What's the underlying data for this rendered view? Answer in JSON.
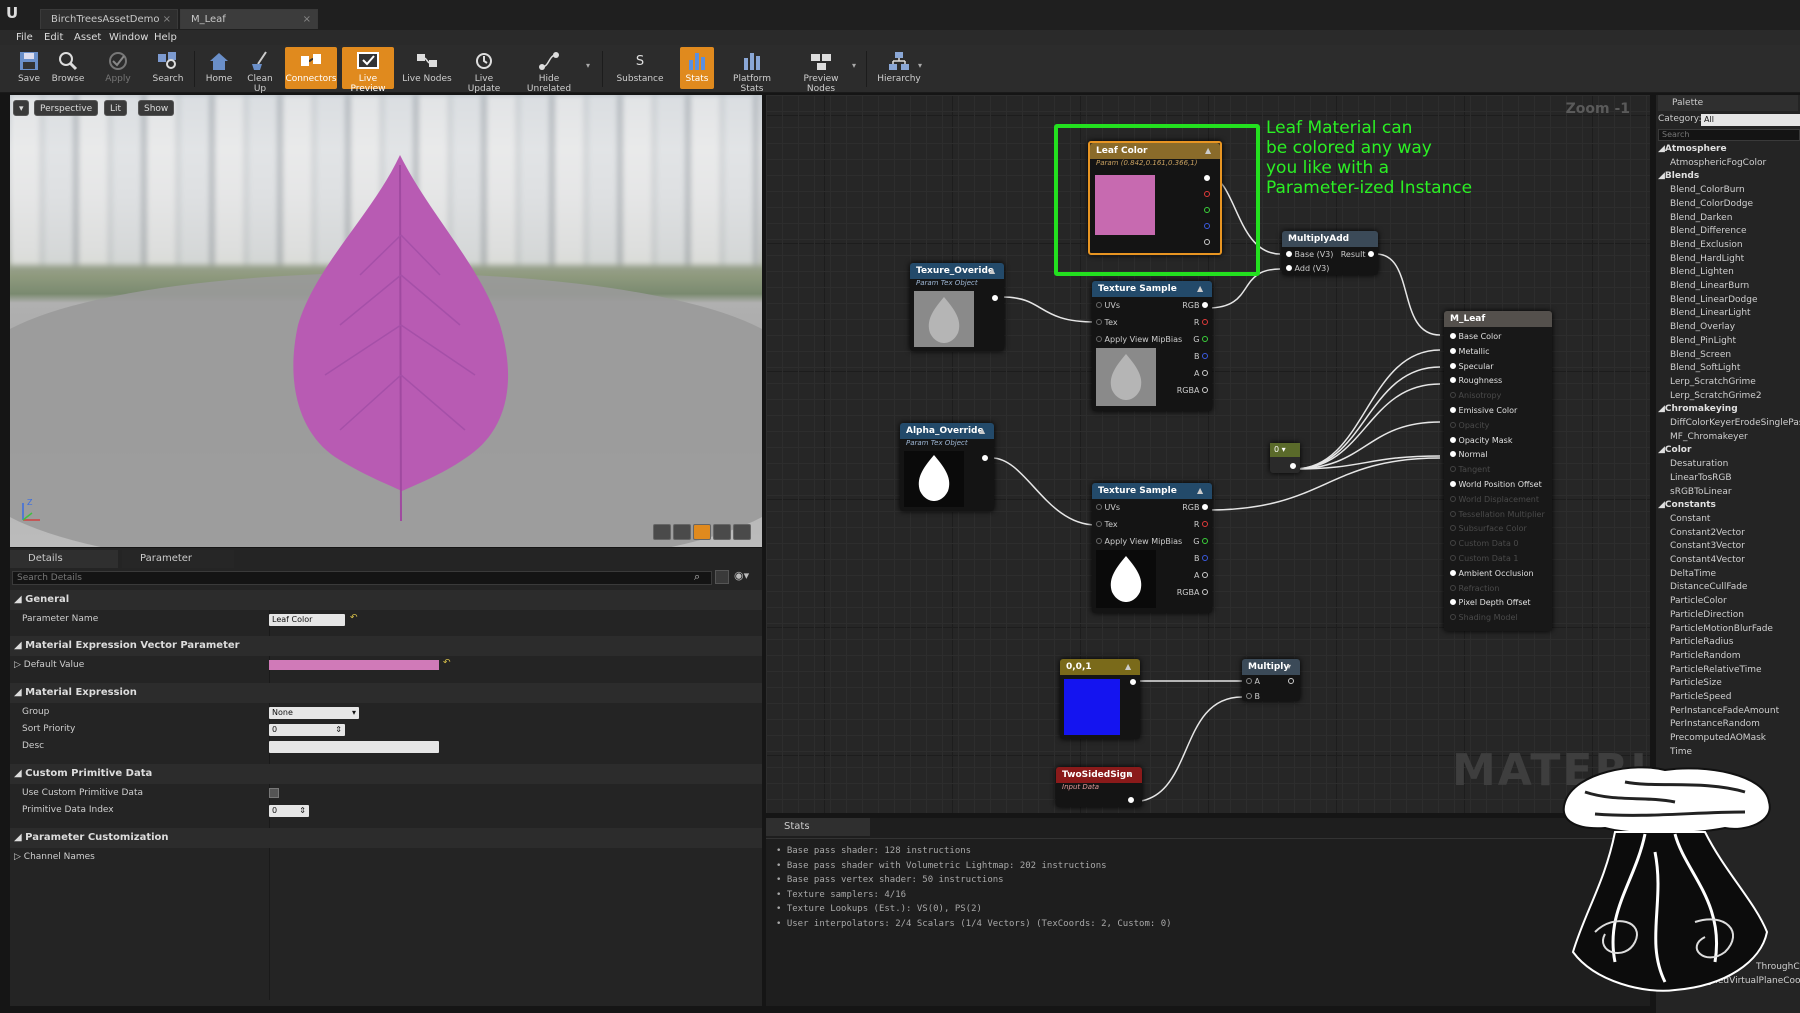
{
  "tabs": [
    {
      "label": "BirchTreesAssetDemo"
    },
    {
      "label": "M_Leaf"
    }
  ],
  "menu": [
    "File",
    "Edit",
    "Asset",
    "Window",
    "Help"
  ],
  "toolbar": [
    {
      "label": "Save",
      "icon": "save-icon"
    },
    {
      "label": "Browse",
      "icon": "browse-icon"
    },
    {
      "label": "Apply",
      "icon": "apply-icon"
    },
    {
      "label": "Search",
      "icon": "search-icon"
    },
    {
      "label": "Home",
      "icon": "home-icon"
    },
    {
      "label": "Clean Up",
      "icon": "cleanup-icon"
    },
    {
      "label": "Connectors",
      "icon": "connectors-icon",
      "active": true
    },
    {
      "label": "Live Preview",
      "icon": "live-preview-icon",
      "active": true
    },
    {
      "label": "Live Nodes",
      "icon": "live-nodes-icon"
    },
    {
      "label": "Live Update",
      "icon": "live-update-icon"
    },
    {
      "label": "Hide Unrelated",
      "icon": "hide-unrelated-icon"
    },
    {
      "label": "Substance",
      "icon": "substance-icon"
    },
    {
      "label": "Stats",
      "icon": "stats-icon",
      "active": true
    },
    {
      "label": "Platform Stats",
      "icon": "platform-stats-icon"
    },
    {
      "label": "Preview Nodes",
      "icon": "preview-nodes-icon"
    },
    {
      "label": "Hierarchy",
      "icon": "hierarchy-icon"
    }
  ],
  "viewport": {
    "perspective": "Perspective",
    "lit": "Lit",
    "show": "Show",
    "axis_z": "Z"
  },
  "details": {
    "tab_details": "Details",
    "tab_params": "Parameter Defaults",
    "search_placeholder": "Search Details",
    "cat_general": "General",
    "parameter_name_label": "Parameter Name",
    "parameter_name_value": "Leaf Color",
    "cat_vector": "Material Expression Vector Parameter",
    "default_value_label": "Default Value",
    "default_value_color": "#d07ab8",
    "cat_expression": "Material Expression",
    "group_label": "Group",
    "group_value": "None",
    "sort_priority_label": "Sort Priority",
    "sort_priority_value": "0",
    "desc_label": "Desc",
    "cat_custom": "Custom Primitive Data",
    "use_custom_label": "Use Custom Primitive Data",
    "prim_index_label": "Primitive Data Index",
    "prim_index_value": "0",
    "cat_param_custom": "Parameter Customization",
    "channel_names_label": "Channel Names"
  },
  "graph": {
    "zoom": "Zoom -1",
    "watermark": "MATERIAL",
    "leaf_color": {
      "title": "Leaf Color",
      "subtitle": "Param (0.842,0.161,0.366,1)",
      "swatch": "#c76ab0"
    },
    "tex_override": {
      "title": "Texure_Overide",
      "subtitle": "Param Tex Object"
    },
    "alpha_override": {
      "title": "Alpha_Override",
      "subtitle": "Param Tex Object"
    },
    "multiply_add": {
      "title": "MultiplyAdd",
      "pin_a": "Base (V3)",
      "pin_out": "Result",
      "pin_b": "Add (V3)"
    },
    "tex_sample": {
      "title": "Texture Sample",
      "uvs": "UVs",
      "tex": "Tex",
      "mip": "Apply View MipBias",
      "rgb": "RGB",
      "r": "R",
      "g": "G",
      "b": "B",
      "a": "A",
      "rgba": "RGBA"
    },
    "const_zero": "0",
    "const_vec": {
      "title": "0,0,1",
      "swatch": "#1414f0"
    },
    "multiply": {
      "title": "Multiply",
      "a": "A",
      "b": "B"
    },
    "two_sided": {
      "title": "TwoSidedSign",
      "subtitle": "Input Data"
    },
    "m_leaf": {
      "title": "M_Leaf",
      "pins": [
        {
          "label": "Base Color",
          "active": true
        },
        {
          "label": "Metallic",
          "active": true
        },
        {
          "label": "Specular",
          "active": true
        },
        {
          "label": "Roughness",
          "active": true
        },
        {
          "label": "Anisotropy",
          "active": false
        },
        {
          "label": "Emissive Color",
          "active": true
        },
        {
          "label": "Opacity",
          "active": false
        },
        {
          "label": "Opacity Mask",
          "active": true
        },
        {
          "label": "Normal",
          "active": true
        },
        {
          "label": "Tangent",
          "active": false
        },
        {
          "label": "World Position Offset",
          "active": true
        },
        {
          "label": "World Displacement",
          "active": false
        },
        {
          "label": "Tessellation Multiplier",
          "active": false
        },
        {
          "label": "Subsurface Color",
          "active": false
        },
        {
          "label": "Custom Data 0",
          "active": false
        },
        {
          "label": "Custom Data 1",
          "active": false
        },
        {
          "label": "Ambient Occlusion",
          "active": true
        },
        {
          "label": "Refraction",
          "active": false
        },
        {
          "label": "Pixel Depth Offset",
          "active": true
        },
        {
          "label": "Shading Model",
          "active": false
        }
      ]
    }
  },
  "annotation": [
    "Leaf Material can",
    "be colored any way",
    "you like with a",
    "Parameter-ized Instance"
  ],
  "palette": {
    "title": "Palette",
    "category_label": "Category:",
    "category_value": "All",
    "search_placeholder": "Search",
    "items": [
      {
        "text": "Atmosphere",
        "cat": true
      },
      {
        "text": "AtmosphericFogColor"
      },
      {
        "text": "Blends",
        "cat": true
      },
      {
        "text": "Blend_ColorBurn"
      },
      {
        "text": "Blend_ColorDodge"
      },
      {
        "text": "Blend_Darken"
      },
      {
        "text": "Blend_Difference"
      },
      {
        "text": "Blend_Exclusion"
      },
      {
        "text": "Blend_HardLight"
      },
      {
        "text": "Blend_Lighten"
      },
      {
        "text": "Blend_LinearBurn"
      },
      {
        "text": "Blend_LinearDodge"
      },
      {
        "text": "Blend_LinearLight"
      },
      {
        "text": "Blend_Overlay"
      },
      {
        "text": "Blend_PinLight"
      },
      {
        "text": "Blend_Screen"
      },
      {
        "text": "Blend_SoftLight"
      },
      {
        "text": "Lerp_ScratchGrime"
      },
      {
        "text": "Lerp_ScratchGrime2"
      },
      {
        "text": "Chromakeying",
        "cat": true
      },
      {
        "text": "DiffColorKeyerErodeSinglePass"
      },
      {
        "text": "MF_Chromakeyer"
      },
      {
        "text": "Color",
        "cat": true
      },
      {
        "text": "Desaturation"
      },
      {
        "text": "LinearTosRGB"
      },
      {
        "text": "sRGBToLinear"
      },
      {
        "text": "Constants",
        "cat": true
      },
      {
        "text": "Constant"
      },
      {
        "text": "Constant2Vector"
      },
      {
        "text": "Constant3Vector"
      },
      {
        "text": "Constant4Vector"
      },
      {
        "text": "DeltaTime"
      },
      {
        "text": "DistanceCullFade"
      },
      {
        "text": "ParticleColor"
      },
      {
        "text": "ParticleDirection"
      },
      {
        "text": "ParticleMotionBlurFade"
      },
      {
        "text": "ParticleRadius"
      },
      {
        "text": "ParticleRandom"
      },
      {
        "text": "ParticleRelativeTime"
      },
      {
        "text": "ParticleSize"
      },
      {
        "text": "ParticleSpeed"
      },
      {
        "text": "PerInstanceFadeAmount"
      },
      {
        "text": "PerInstanceRandom"
      },
      {
        "text": "PrecomputedAOMask"
      },
      {
        "text": "Time"
      }
    ],
    "bottom_items": [
      "ThroughCameraUV",
      "ObjectAlignedVirtualPlaneCoord"
    ]
  },
  "stats": {
    "tab": "Stats",
    "lines": [
      "Base pass shader: 128 instructions",
      "Base pass shader with Volumetric Lightmap: 202 instructions",
      "Base pass vertex shader: 50 instructions",
      "Texture samplers: 4/16",
      "Texture Lookups (Est.): VS(0), PS(2)",
      "User interpolators: 2/4 Scalars (1/4 Vectors) (TexCoords: 2, Custom: 0)"
    ]
  },
  "colors": {
    "accent_orange": "#e08a1e",
    "annotation_green": "#23e01f",
    "leaf_pink": "#c76ab0"
  }
}
